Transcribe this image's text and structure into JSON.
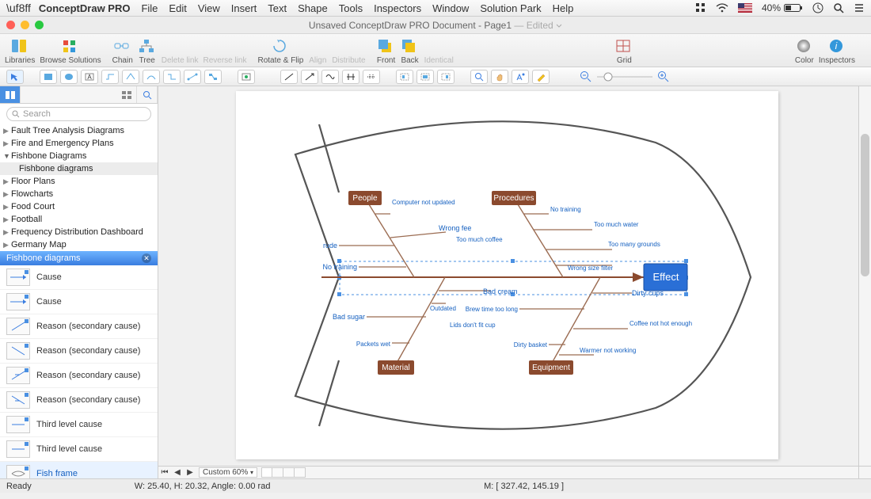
{
  "menubar": {
    "app": "ConceptDraw PRO",
    "items": [
      "File",
      "Edit",
      "View",
      "Insert",
      "Text",
      "Shape",
      "Tools",
      "Inspectors",
      "Window",
      "Solution Park",
      "Help"
    ],
    "battery": "40%"
  },
  "window": {
    "title": "Unsaved ConceptDraw PRO Document - Page1",
    "edited": "— Edited"
  },
  "toolbar": {
    "libraries": "Libraries",
    "browse": "Browse Solutions",
    "chain": "Chain",
    "tree": "Tree",
    "delete_link": "Delete link",
    "reverse_link": "Reverse link",
    "rotate": "Rotate & Flip",
    "align": "Align",
    "distribute": "Distribute",
    "front": "Front",
    "back": "Back",
    "identical": "Identical",
    "grid": "Grid",
    "color": "Color",
    "inspectors": "Inspectors"
  },
  "search": {
    "placeholder": "Search"
  },
  "tree": [
    {
      "label": "Fault Tree Analysis Diagrams",
      "expanded": false
    },
    {
      "label": "Fire and Emergency Plans",
      "expanded": false
    },
    {
      "label": "Fishbone Diagrams",
      "expanded": true,
      "children": [
        {
          "label": "Fishbone diagrams"
        }
      ]
    },
    {
      "label": "Floor Plans",
      "expanded": false
    },
    {
      "label": "Flowcharts",
      "expanded": false
    },
    {
      "label": "Food Court",
      "expanded": false
    },
    {
      "label": "Football",
      "expanded": false
    },
    {
      "label": "Frequency Distribution Dashboard",
      "expanded": false
    },
    {
      "label": "Germany Map",
      "expanded": false
    }
  ],
  "library": {
    "header": "Fishbone diagrams",
    "items": [
      {
        "label": "Cause"
      },
      {
        "label": "Cause"
      },
      {
        "label": "Reason (secondary cause)"
      },
      {
        "label": "Reason (secondary cause)"
      },
      {
        "label": "Reason (secondary cause)"
      },
      {
        "label": "Reason (secondary cause)"
      },
      {
        "label": "Third level cause"
      },
      {
        "label": "Third level cause"
      },
      {
        "label": "Fish frame",
        "selected": true
      }
    ]
  },
  "fishbone": {
    "effect": "Effect",
    "categories": {
      "people": "People",
      "procedures": "Procedures",
      "material": "Material",
      "equipment": "Equipment"
    },
    "causes": {
      "computer_not_updated": "Computer not updated",
      "wrong_fee": "Wrong fee",
      "too_much_coffee": "Too much coffee",
      "rude": "rude",
      "no_training_l": "No training",
      "no_training_r": "No training",
      "too_much_water": "Too much water",
      "too_many_grounds": "Too many grounds",
      "wrong_size_filter": "Wrong size filter",
      "bad_cream": "Bad cream",
      "bad_sugar": "Bad sugar",
      "outdated": "Outdated",
      "packets_wet": "Packets wet",
      "lids_dont_fit": "Lids don't fit cup",
      "brew_time": "Brew time too long",
      "dirty_basket": "Dirty basket",
      "dirty_cups": "Dirty cups",
      "coffee_not_hot": "Coffee not hot enough",
      "warmer_not_working": "Warmer not working"
    }
  },
  "hscroll": {
    "custom": "Custom 60%"
  },
  "status": {
    "ready": "Ready",
    "dims": "W: 25.40,  H: 20.32,  Angle: 0.00 rad",
    "mouse": "M: [ 327.42, 145.19 ]"
  }
}
